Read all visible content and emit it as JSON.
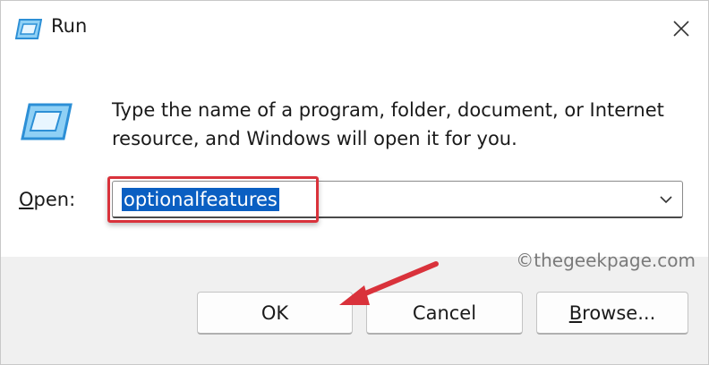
{
  "window": {
    "title": "Run",
    "title_icon": "run-app-icon",
    "close_icon": "close-icon"
  },
  "dialog": {
    "icon": "run-app-icon",
    "description": "Type the name of a program, folder, document, or Internet resource, and Windows will open it for you.",
    "open_label_accel": "O",
    "open_label_rest": "pen:",
    "open_value": "optionalfeatures",
    "dropdown_icon": "chevron-down-icon"
  },
  "buttons": {
    "ok_label": "OK",
    "cancel_label": "Cancel",
    "browse_accel": "B",
    "browse_rest": "rowse..."
  },
  "watermark": "©thegeekpage.com",
  "colors": {
    "selection": "#0a5fc2",
    "annotation_red": "#d9323b",
    "footer_bg": "#f0f0f0"
  }
}
